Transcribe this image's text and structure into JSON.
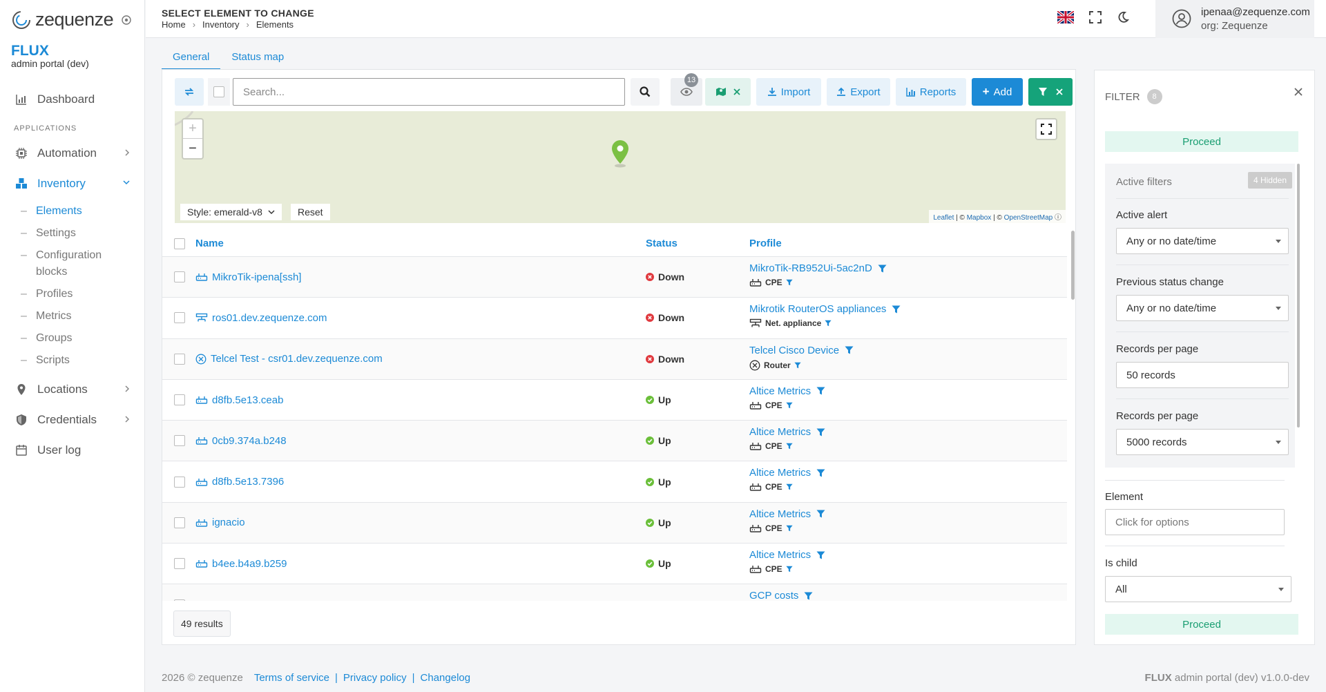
{
  "app": {
    "logo_text": "zequenze",
    "brand": "FLUX",
    "brand_sub": "admin portal (dev)"
  },
  "sidebar": {
    "dashboard": "Dashboard",
    "section_applications": "APPLICATIONS",
    "automation": "Automation",
    "inventory": "Inventory",
    "inventory_items": [
      "Elements",
      "Settings",
      "Configuration blocks",
      "Profiles",
      "Metrics",
      "Groups",
      "Scripts"
    ],
    "locations": "Locations",
    "credentials": "Credentials",
    "user_log": "User log"
  },
  "header": {
    "title": "SELECT ELEMENT TO CHANGE",
    "breadcrumb": [
      "Home",
      "Inventory",
      "Elements"
    ],
    "user_email": "ipenaa@zequenze.com",
    "user_org": "org: Zequenze"
  },
  "tabs": [
    "General",
    "Status map"
  ],
  "toolbar": {
    "search_placeholder": "Search...",
    "visibility_count": "13",
    "import": "Import",
    "export": "Export",
    "reports": "Reports",
    "add": "Add"
  },
  "map": {
    "style_label": "Style: emerald-v8",
    "reset": "Reset",
    "attribution_leaflet": "Leaflet",
    "attribution_mapbox": "Mapbox",
    "attribution_osm": "OpenStreetMap"
  },
  "table": {
    "columns": [
      "Name",
      "Status",
      "Profile"
    ],
    "rows": [
      {
        "icon": "cpe",
        "name": "MikroTik-ipena[ssh]",
        "status": "Down",
        "profile": "MikroTik-RB952Ui-5ac2nD",
        "type_icon": "cpe",
        "type": "CPE"
      },
      {
        "icon": "appliance",
        "name": "ros01.dev.zequenze.com",
        "status": "Down",
        "profile": "Mikrotik RouterOS appliances",
        "type_icon": "appliance",
        "type": "Net. appliance"
      },
      {
        "icon": "router",
        "name": "Telcel Test - csr01.dev.zequenze.com",
        "status": "Down",
        "profile": "Telcel Cisco Device",
        "type_icon": "router",
        "type": "Router"
      },
      {
        "icon": "cpe",
        "name": "d8fb.5e13.ceab",
        "status": "Up",
        "profile": "Altice Metrics",
        "type_icon": "cpe",
        "type": "CPE"
      },
      {
        "icon": "cpe",
        "name": "0cb9.374a.b248",
        "status": "Up",
        "profile": "Altice Metrics",
        "type_icon": "cpe",
        "type": "CPE"
      },
      {
        "icon": "cpe",
        "name": "d8fb.5e13.7396",
        "status": "Up",
        "profile": "Altice Metrics",
        "type_icon": "cpe",
        "type": "CPE"
      },
      {
        "icon": "cpe",
        "name": "ignacio",
        "status": "Up",
        "profile": "Altice Metrics",
        "type_icon": "cpe",
        "type": "CPE"
      },
      {
        "icon": "cpe",
        "name": "b4ee.b4a9.b259",
        "status": "Up",
        "profile": "Altice Metrics",
        "type_icon": "cpe",
        "type": "CPE"
      },
      {
        "icon": "cpe",
        "name": "",
        "status": "",
        "profile": "GCP costs",
        "type_icon": "",
        "type": ""
      }
    ],
    "results": "49 results"
  },
  "filter": {
    "title": "FILTER",
    "count": "8",
    "proceed": "Proceed",
    "active_filters": "Active filters",
    "hidden": "4 Hidden",
    "active_alert_label": "Active alert",
    "active_alert_value": "Any or no date/time",
    "prev_status_label": "Previous status change",
    "prev_status_value": "Any or no date/time",
    "records_label_1": "Records per page",
    "records_value_1": "50 records",
    "records_label_2": "Records per page",
    "records_value_2": "5000 records",
    "element_label": "Element",
    "element_placeholder": "Click for options",
    "is_child_label": "Is child",
    "is_child_value": "All"
  },
  "footer": {
    "copyright": "2026 © zequenze",
    "links": [
      "Terms of service",
      "Privacy policy",
      "Changelog"
    ],
    "version_brand": "FLUX",
    "version_text": "admin portal (dev) v1.0.0-dev"
  },
  "colors": {
    "accent": "#1c8ad6",
    "success": "#15a37a",
    "down": "#e0393e",
    "up": "#6bbf3a"
  }
}
